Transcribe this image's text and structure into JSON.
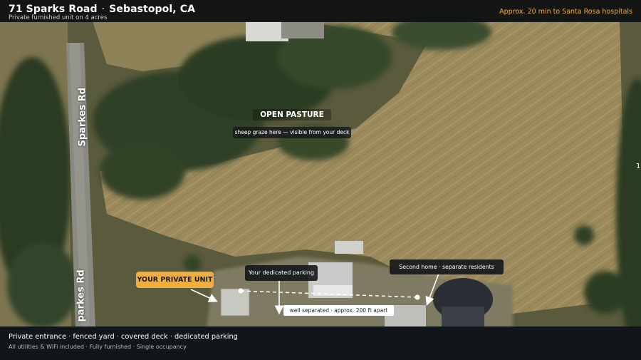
{
  "header": {
    "address": "71 Sparks Road",
    "city": "Sebastopol, CA",
    "subtitle": "Private furnished unit on 4 acres",
    "drive_note": "Approx. 20 min to Santa Rosa hospitals"
  },
  "map": {
    "road_label_upper": "Sparkes Rd",
    "road_label_lower": "parkes Rd",
    "pasture_title": "OPEN PASTURE",
    "pasture_note": "sheep graze here — visible from your deck",
    "unit_label": "YOUR PRIVATE UNIT",
    "parking_label": "Your dedicated parking",
    "second_home_label": "Second home · separate residents",
    "separation_label": "well separated · approx. 200 ft apart",
    "edge_mark": "1"
  },
  "footer": {
    "features": [
      "Private entrance",
      "fenced yard",
      "covered deck",
      "dedicated parking"
    ],
    "details": [
      "All utilities & WiFi included",
      "Fully furnished",
      "Single occupancy"
    ]
  },
  "colors": {
    "accent": "#f2ad3f",
    "bar_background": "#121519",
    "label_background": "#14161a",
    "pasture": "#9c8a5c",
    "trees": "#2f4126"
  }
}
